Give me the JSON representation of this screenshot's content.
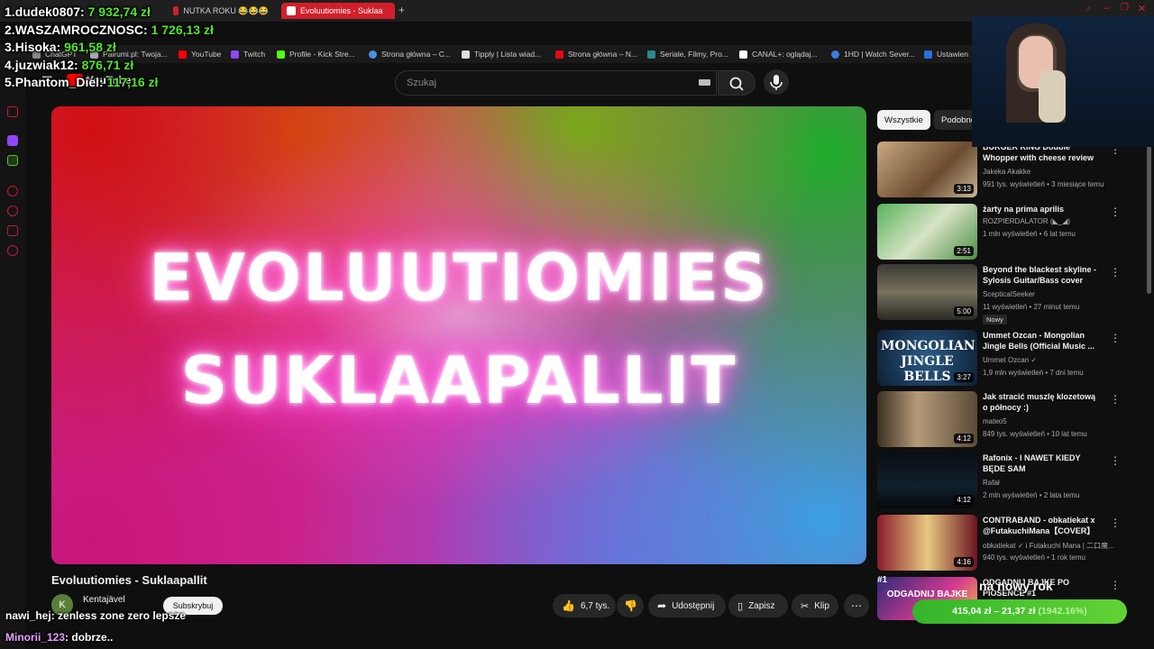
{
  "browser": {
    "tabs": [
      {
        "label": "NUTKA ROKU 😂😂😂",
        "active": false
      },
      {
        "label": "Evoluutiomies - Suklaa",
        "active": true
      }
    ],
    "bookmarks": [
      "ChatGPT",
      "Pairumi.pl: Twoja...",
      "YouTube",
      "Twitch",
      "Profile - Kick Stre...",
      "Strona główna – C...",
      "Tipply | Lista wiad...",
      "Strona główna – N...",
      "Seriale, Filmy, Pro...",
      "CANAL+: oglądaj...",
      "1HD | Watch Sever...",
      "Ustawien"
    ]
  },
  "youtube": {
    "logo": "YouTube",
    "search_placeholder": "Szukaj"
  },
  "video": {
    "overlay_line1": "EVOLUUTIOMIES",
    "overlay_line2": "SUKLAAPALLIT",
    "title": "Evoluutiomies - Suklaapallit",
    "channel": "Kentajävel",
    "channel_initial": "K",
    "subscribe_label": "Subskrybuj",
    "likes": "6,7 tys.",
    "share_label": "Udostępnij",
    "save_label": "Zapisz",
    "clip_label": "Klip"
  },
  "chips": [
    "Wszystkie",
    "Podobne"
  ],
  "recommendations": [
    {
      "title": "BURGER KING Double Whopper with cheese review",
      "channel": "Jakeka Akakke",
      "meta": "991 tys. wyświetleń • 3 miesiące temu",
      "duration": "3:13"
    },
    {
      "title": "żarty na prima aprilis",
      "channel": "ROZPIERDALATOR (◣_◢)",
      "meta": "1 mln wyświetleń • 6 lat temu",
      "duration": "2:51"
    },
    {
      "title": "Beyond the blackest skyline - Sylosis Guitar/Bass cover",
      "channel": "ScepticalSeeker",
      "meta": "11 wyświetleń • 27 minut temu",
      "duration": "5:00",
      "badge": "Nowy"
    },
    {
      "title": "Ummet Ozcan - Mongolian Jingle Bells (Official Music ...",
      "channel": "Ummet Ozcan",
      "meta": "1,9 mln wyświetleń • 7 dni temu",
      "duration": "3:27"
    },
    {
      "title": "Jak stracić muszlę klozetową o północy :)",
      "channel": "mateo5",
      "meta": "849 tys. wyświetleń • 10 lat temu",
      "duration": "4:12"
    },
    {
      "title": "Rafonix - I NAWET KIEDY BĘDE SAM",
      "channel": "Rafał",
      "meta": "2 mln wyświetleń • 2 lata temu",
      "duration": "4:12"
    },
    {
      "title": "CONTRABAND - obkatiekat x @FutakuchiMana【COVER】",
      "channel": "obkatiekat ✓ i Futakuchi Mana | 二口魔...",
      "meta": "940 tys. wyświetleń • 1 rok temu",
      "duration": "4:16"
    },
    {
      "title": "ODGADNIJ BAJKE PO PIOSENCE #1",
      "channel": "",
      "meta": "",
      "duration": ""
    }
  ],
  "mongolian_thumb_text": "MONGOLIAN JINGLE BELLS",
  "odgadnij_thumb_text": "ODGADNIJ BAJKE",
  "rank_badge": "#1",
  "leaderboard": [
    {
      "rank": "1.",
      "name": "dudek0807:",
      "amount": "7 932,74 zł"
    },
    {
      "rank": "2.",
      "name": "WASZAMROCZNOSC:",
      "amount": "1 726,13 zł"
    },
    {
      "rank": "3.",
      "name": "Hisoka:",
      "amount": "961,58 zł"
    },
    {
      "rank": "4.",
      "name": "juzwiak12:",
      "amount": "876,71 zł"
    },
    {
      "rank": "5.",
      "name": "Phantom_Diel:",
      "amount": "117,16 zł"
    }
  ],
  "chat": [
    {
      "user": "nawi_hej",
      "message": ": zenless zone zero lepsze",
      "color": "#ffffff"
    },
    {
      "user": "Minorii_123",
      "message": ": dobrze..",
      "color": "#e8a0ff"
    }
  ],
  "goal": {
    "title": "na nowy rok",
    "text": "415,04 zł",
    "of": "21,37 zł",
    "percent": "(1942.16%)"
  },
  "colors": {
    "accent": "#d11f2a",
    "donation_green": "#52e52b",
    "goal_green": "#3cbf2e"
  }
}
